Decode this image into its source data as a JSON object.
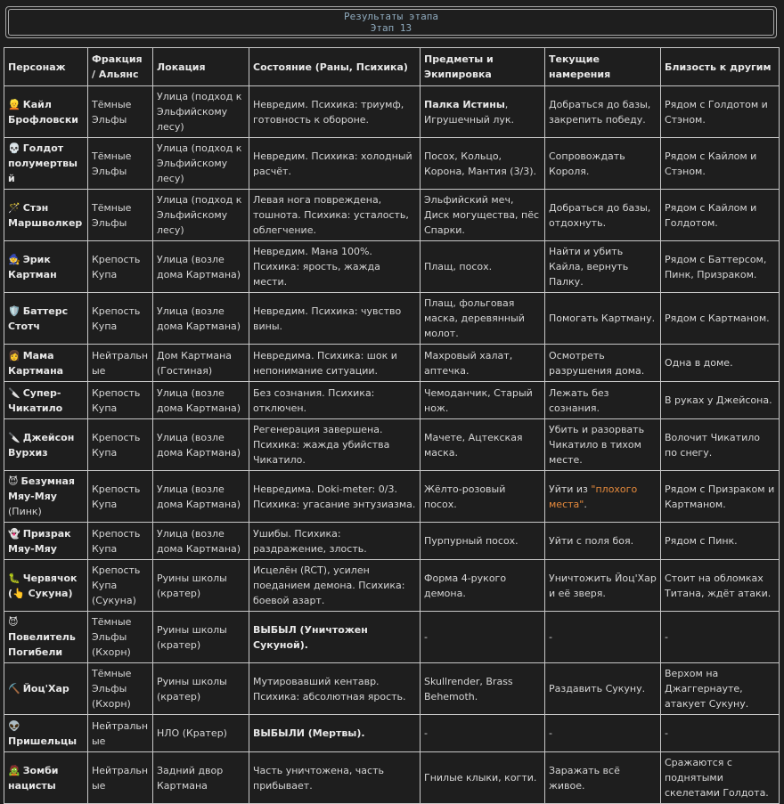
{
  "banner": {
    "title": "Результаты этапа",
    "subtitle": "Этап 13"
  },
  "columns": [
    "Персонаж",
    "Фракция / Альянс",
    "Локация",
    "Состояние (Раны, Психика)",
    "Предметы и Экипировка",
    "Текущие намерения",
    "Близость к другим"
  ],
  "rows": [
    {
      "icon": "👱",
      "name": "Кайл Брофловски",
      "faction": "Тёмные Эльфы",
      "location": "Улица (подход к Эльфийскому лесу)",
      "status": "Невредим. Психика: триумф, готовность к обороне.",
      "items_bold": "Палка Истины",
      "items": ", Игрушечный лук.",
      "intent": "Добраться до базы, закрепить победу.",
      "proximity": "Рядом с Голдотом и Стэном."
    },
    {
      "icon": "💀",
      "name": "Голдот полумертвый",
      "faction": "Тёмные Эльфы",
      "location": "Улица (подход к Эльфийскому лесу)",
      "status": "Невредим. Психика: холодный расчёт.",
      "items": "Посох, Кольцо, Корона, Мантия (3/3).",
      "intent": "Сопровождать Короля.",
      "proximity": "Рядом с Кайлом и Стэном."
    },
    {
      "icon": "🪄",
      "name": "Стэн Маршволкер",
      "faction": "Тёмные Эльфы",
      "location": "Улица (подход к Эльфийскому лесу)",
      "status": "Левая нога повреждена, тошнота. Психика: усталость, облегчение.",
      "items": "Эльфийский меч, Диск могущества, пёс Спарки.",
      "intent": "Добраться до базы, отдохнуть.",
      "proximity": "Рядом с Кайлом и Голдотом."
    },
    {
      "icon": "🧙",
      "name": "Эрик Картман",
      "faction": "Крепость Купа",
      "location": "Улица (возле дома Картмана)",
      "status": "Невредим. Мана 100%. Психика: ярость, жажда мести.",
      "items": "Плащ, посох.",
      "intent": "Найти и убить Кайла, вернуть Палку.",
      "proximity": "Рядом с Баттерсом, Пинк, Призраком."
    },
    {
      "icon": "🛡️",
      "name": "Баттерс Стотч",
      "faction": "Крепость Купа",
      "location": "Улица (возле дома Картмана)",
      "status": "Невредим. Психика: чувство вины.",
      "items": "Плащ, фольговая маска, деревянный молот.",
      "intent": "Помогать Картману.",
      "proximity": "Рядом с Картманом."
    },
    {
      "icon": "👩",
      "name": "Мама Картмана",
      "faction": "Нейтральные",
      "location": "Дом Картмана (Гостиная)",
      "status": "Невредима. Психика: шок и непонимание ситуации.",
      "items": "Махровый халат, аптечка.",
      "intent": "Осмотреть разрушения дома.",
      "proximity": "Одна в доме."
    },
    {
      "icon": "🔪",
      "name": "Супер-Чикатило",
      "faction": "Крепость Купа",
      "location": "Улица (возле дома Картмана)",
      "status": "Без сознания. Психика: отключен.",
      "items": "Чемоданчик, Старый нож.",
      "intent": "Лежать без сознания.",
      "proximity": "В руках у Джейсона."
    },
    {
      "icon": "🔪",
      "name": "Джейсон Вурхиз",
      "faction": "Крепость Купа",
      "location": "Улица (возле дома Картмана)",
      "status": "Регенерация завершена. Психика: жажда убийства Чикатило.",
      "items": "Мачете, Ацтекская маска.",
      "intent": "Убить и разорвать Чикатило в тихом месте.",
      "proximity": "Волочит Чикатило по снегу."
    },
    {
      "icon": "😈",
      "name": "Безумная Мяу-Мяу",
      "name_suffix": "(Пинк)",
      "faction": "Крепость Купа",
      "location": "Улица (возле дома Картмана)",
      "status": "Невредима. Doki-meter: 0/3. Психика: угасание энтузиазма.",
      "items": "Жёлто-розовый посох.",
      "intent": "Уйти из ",
      "intent_quote": "\"плохого места\"",
      "intent_end": ".",
      "proximity": "Рядом с Призраком и Картманом."
    },
    {
      "icon": "👻",
      "name": "Призрак Мяу-Мяу",
      "faction": "Крепость Купа",
      "location": "Улица (возле дома Картмана)",
      "status": "Ушибы. Психика: раздражение, злость.",
      "items": "Пурпурный посох.",
      "intent": "Уйти с поля боя.",
      "proximity": "Рядом с Пинк."
    },
    {
      "icon": "🐛",
      "name": "Червячок (",
      "name_icon2": "👆",
      "name_end": " Сукуна)",
      "faction": "Крепость Купа (Сукуна)",
      "location": "Руины школы (кратер)",
      "status": "Исцелён (RCT), усилен поеданием демона. Психика: боевой азарт.",
      "items": "Форма 4-рукого демона.",
      "intent": "Уничтожить Йоц'Хар и её зверя.",
      "proximity": "Стоит на обломках Титана, ждёт атаки."
    },
    {
      "icon": "😈",
      "name": "Повелитель Погибели",
      "faction": "Тёмные Эльфы (Кхорн)",
      "location": "Руины школы (кратер)",
      "status_bold": "ВЫБЫЛ (Уничтожен Сукуной).",
      "items": "-",
      "intent": "-",
      "proximity": "-"
    },
    {
      "icon": "⛏️",
      "name": "Йоц'Хар",
      "faction": "Тёмные Эльфы (Кхорн)",
      "location": "Руины школы (кратер)",
      "status": "Мутировавший кентавр. Психика: абсолютная ярость.",
      "items": "Skullrender, Brass Behemoth.",
      "intent": "Раздавить Сукуну.",
      "proximity": "Верхом на Джаггернауте, атакует Сукуну."
    },
    {
      "icon": "👽",
      "name": "Пришельцы",
      "faction": "Нейтральные",
      "location": "НЛО (Кратер)",
      "status_bold": "ВЫБЫЛИ (Мертвы).",
      "items": "-",
      "intent": "-",
      "proximity": "-"
    },
    {
      "icon": "🧟",
      "name": "Зомби нацисты",
      "faction": "Нейтральные",
      "location": "Задний двор Картмана",
      "status": "Часть уничтожена, часть прибывает.",
      "items": "Гнилые клыки, когти.",
      "intent": "Заражать всё живое.",
      "proximity": "Сражаются с поднятыми скелетами Голдота."
    }
  ]
}
